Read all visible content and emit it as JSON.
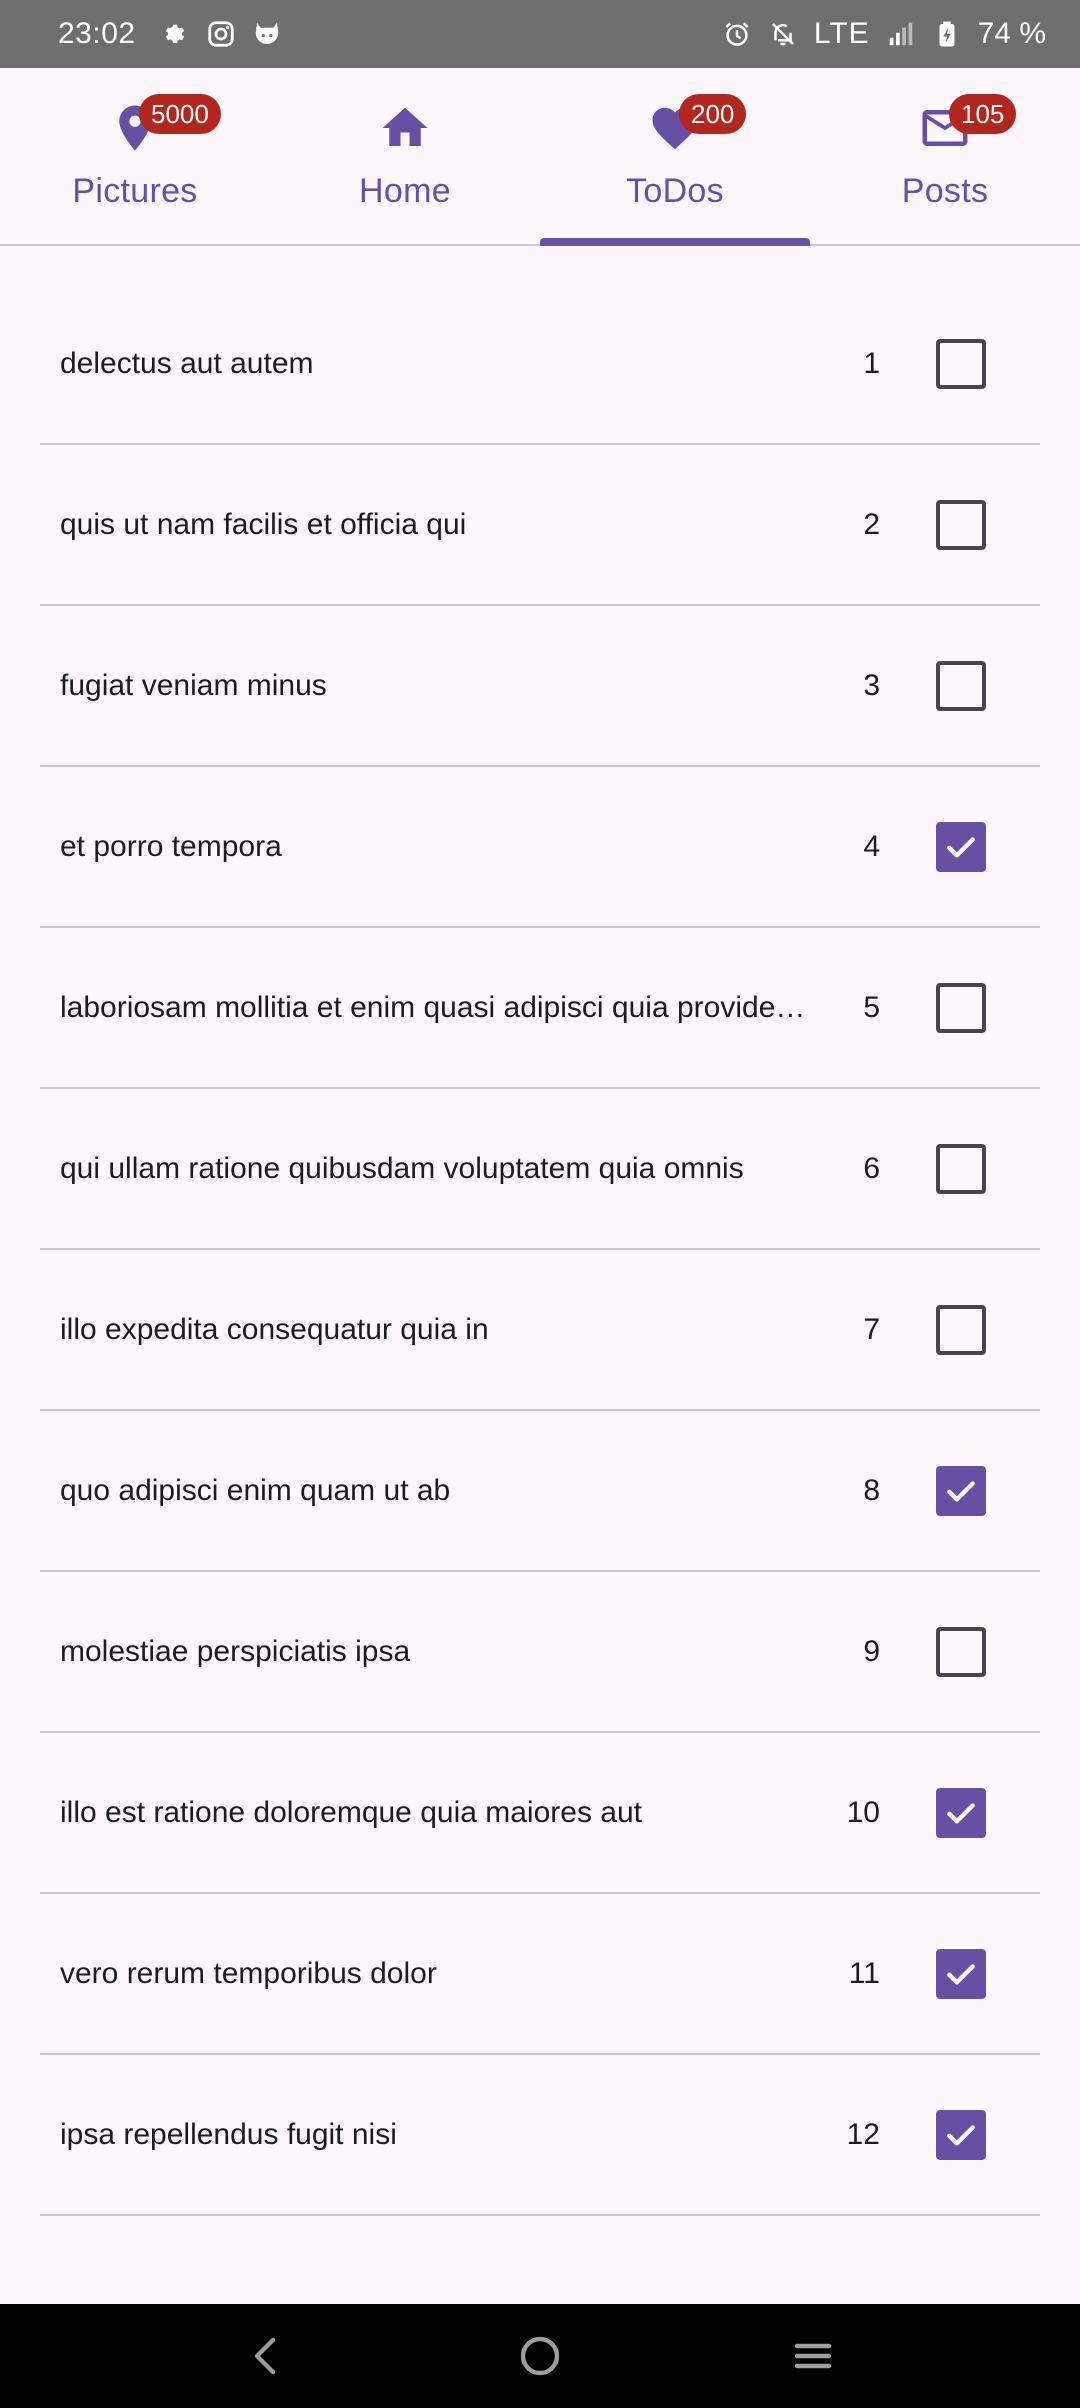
{
  "status_bar": {
    "time": "23:02",
    "left_icons": [
      "settings-icon",
      "instagram-icon",
      "cat-icon"
    ],
    "network": "LTE",
    "battery_percent": "74 %",
    "background": "#6e6e6e"
  },
  "tabs": [
    {
      "label": "Pictures",
      "icon": "location-pin-icon",
      "badge": "5000",
      "selected": false
    },
    {
      "label": "Home",
      "icon": "home-icon",
      "badge": "",
      "selected": false
    },
    {
      "label": "ToDos",
      "icon": "heart-icon",
      "badge": "200",
      "selected": true
    },
    {
      "label": "Posts",
      "icon": "mail-icon",
      "badge": "105",
      "selected": false
    }
  ],
  "colors": {
    "accent": "#6750a4",
    "badge": "#b3261e",
    "background": "#fdf7fb",
    "divider": "#c9c6ca"
  },
  "todos": [
    {
      "title": "delectus aut autem",
      "id": "1",
      "completed": false
    },
    {
      "title": "quis ut nam facilis et officia qui",
      "id": "2",
      "completed": false
    },
    {
      "title": "fugiat veniam minus",
      "id": "3",
      "completed": false
    },
    {
      "title": "et porro tempora",
      "id": "4",
      "completed": true
    },
    {
      "title": "laboriosam mollitia et enim quasi adipisci quia provide…",
      "id": "5",
      "completed": false
    },
    {
      "title": "qui ullam ratione quibusdam voluptatem quia omnis",
      "id": "6",
      "completed": false
    },
    {
      "title": "illo expedita consequatur quia in",
      "id": "7",
      "completed": false
    },
    {
      "title": "quo adipisci enim quam ut ab",
      "id": "8",
      "completed": true
    },
    {
      "title": "molestiae perspiciatis ipsa",
      "id": "9",
      "completed": false
    },
    {
      "title": "illo est ratione doloremque quia maiores aut",
      "id": "10",
      "completed": true
    },
    {
      "title": "vero rerum temporibus dolor",
      "id": "11",
      "completed": true
    },
    {
      "title": "ipsa repellendus fugit nisi",
      "id": "12",
      "completed": true
    }
  ],
  "nav_bar": {
    "buttons": [
      "back-icon",
      "home-circle-icon",
      "recents-menu-icon"
    ]
  }
}
